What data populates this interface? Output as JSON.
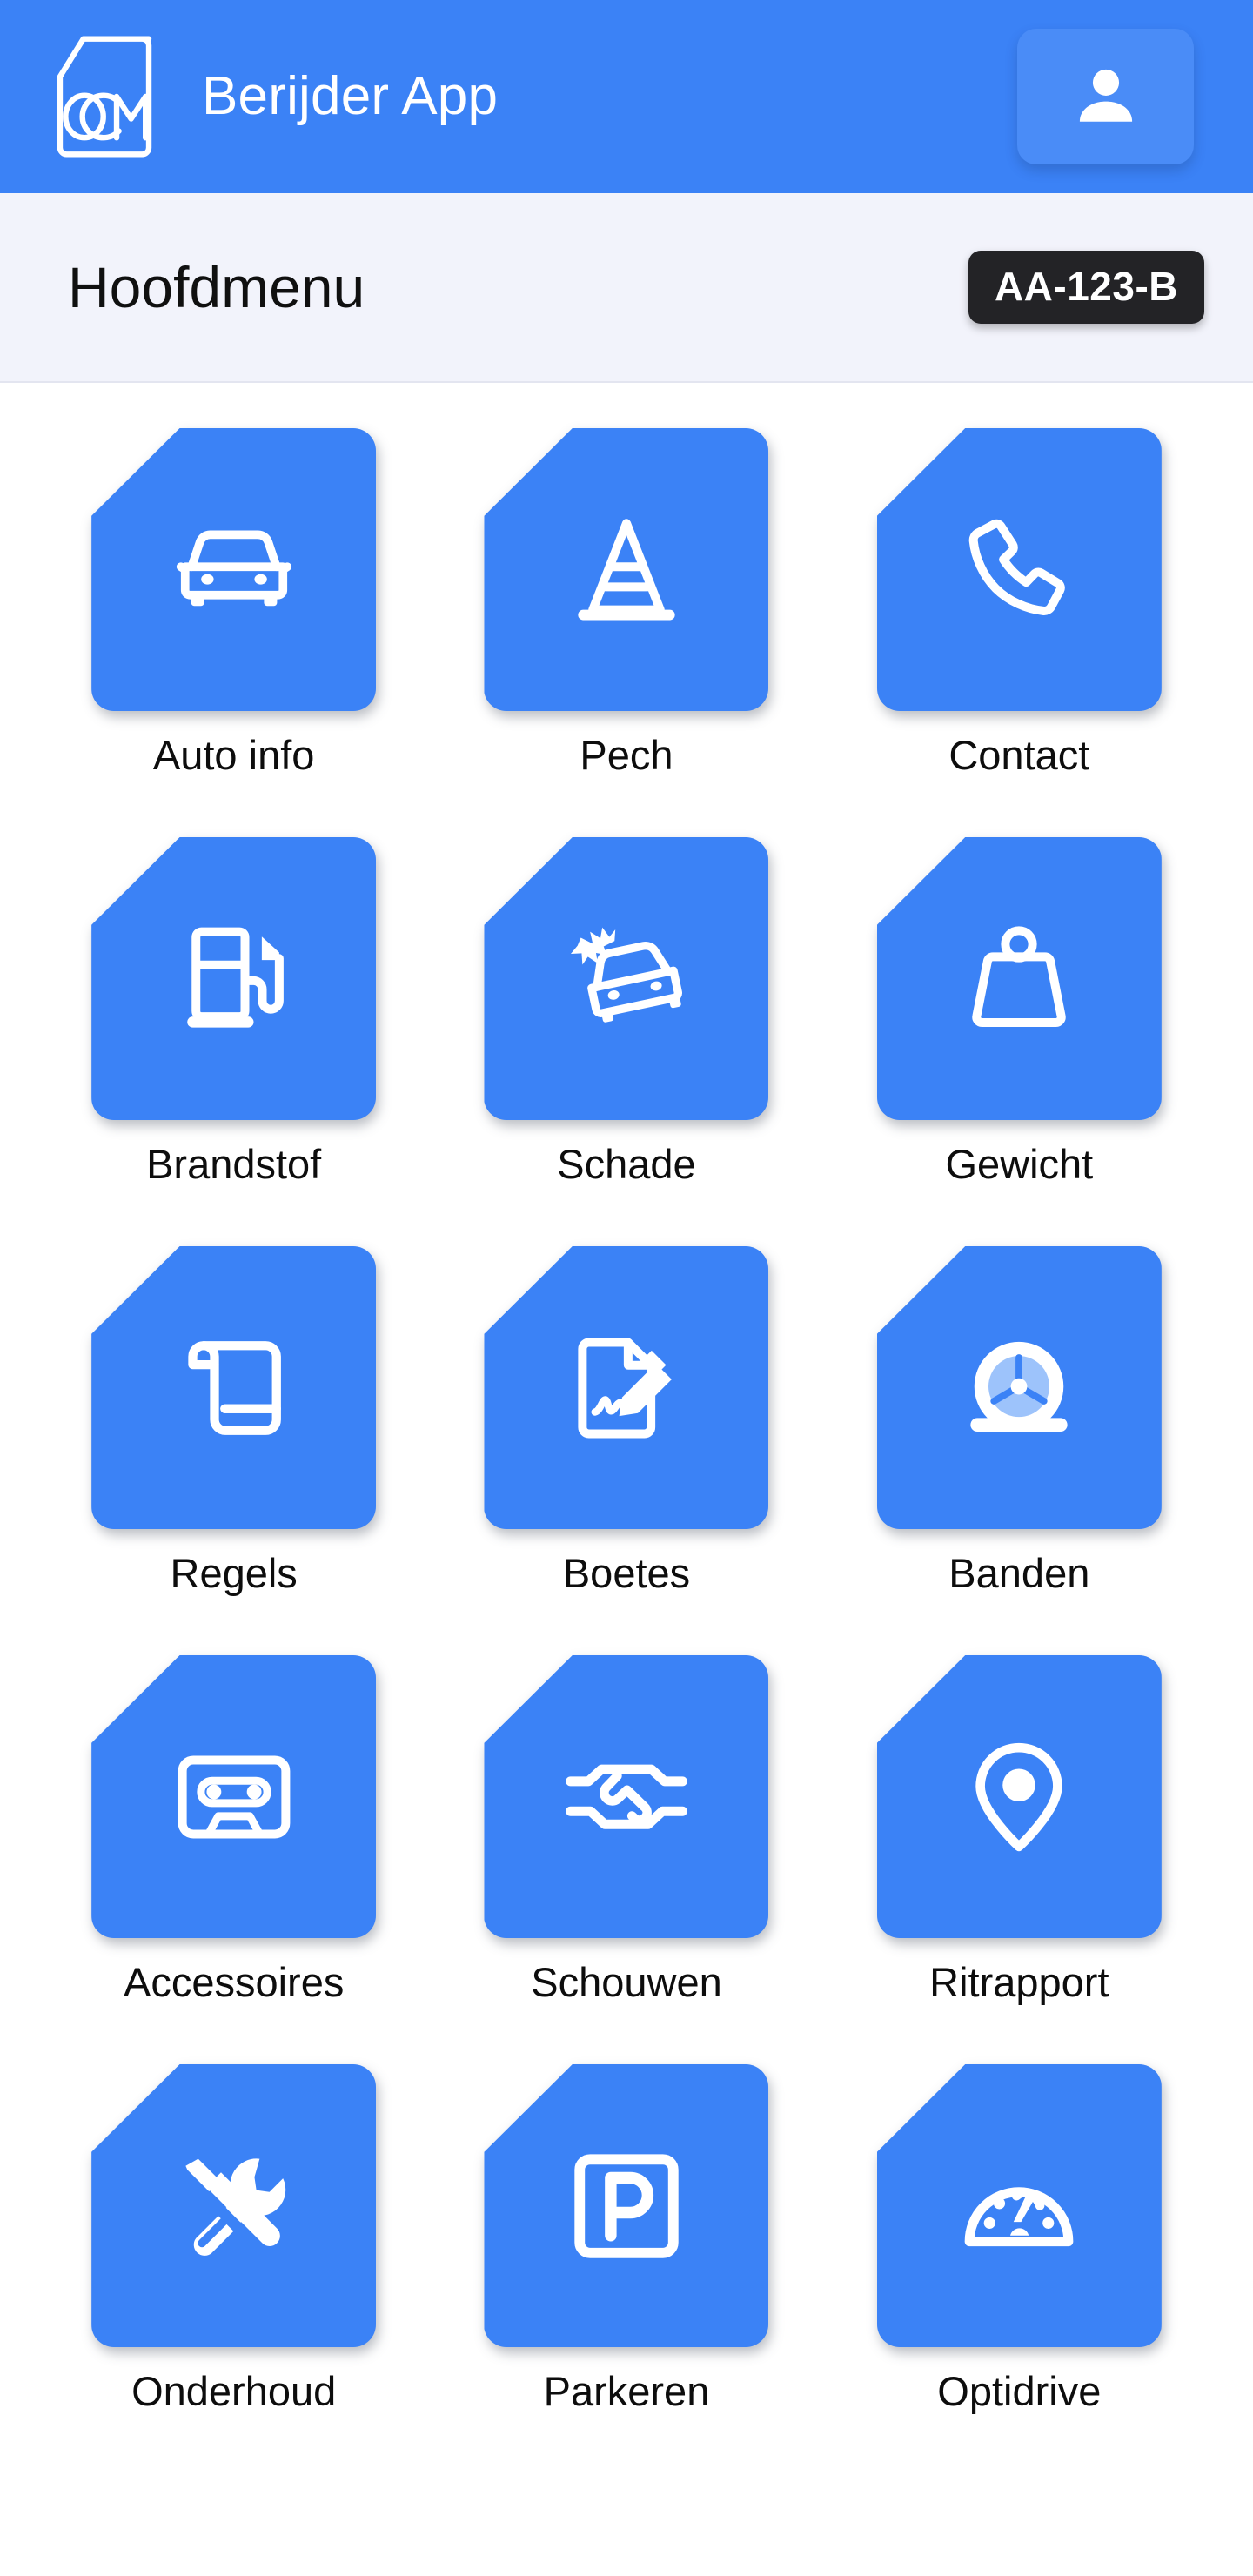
{
  "header": {
    "logo_icon": "ocm-car-door-logo",
    "title": "Berijder App",
    "profile_icon": "person-icon",
    "accent_color": "#3b82f6",
    "title_color": "#ffffff"
  },
  "subheader": {
    "page_title": "Hoofdmenu",
    "license_plate": "AA-123-B",
    "background_color": "#f2f3fb",
    "plate_background": "#232326"
  },
  "menu": {
    "tiles": [
      {
        "label": "Auto info",
        "icon": "car-front-icon"
      },
      {
        "label": "Pech",
        "icon": "traffic-cone-icon"
      },
      {
        "label": "Contact",
        "icon": "phone-icon"
      },
      {
        "label": "Brandstof",
        "icon": "fuel-pump-icon"
      },
      {
        "label": "Schade",
        "icon": "car-crash-icon"
      },
      {
        "label": "Gewicht",
        "icon": "weight-icon"
      },
      {
        "label": "Regels",
        "icon": "scroll-icon"
      },
      {
        "label": "Boetes",
        "icon": "document-signature-pen-icon"
      },
      {
        "label": "Banden",
        "icon": "tire-wheel-icon"
      },
      {
        "label": "Accessoires",
        "icon": "cassette-tape-icon"
      },
      {
        "label": "Schouwen",
        "icon": "handshake-icon"
      },
      {
        "label": "Ritrapport",
        "icon": "location-pin-icon"
      },
      {
        "label": "Onderhoud",
        "icon": "screwdriver-wrench-icon"
      },
      {
        "label": "Parkeren",
        "icon": "parking-p-icon"
      },
      {
        "label": "Optidrive",
        "icon": "speedometer-icon"
      }
    ],
    "tile_color": "#3b82f6",
    "label_color": "#0d0d0d"
  }
}
